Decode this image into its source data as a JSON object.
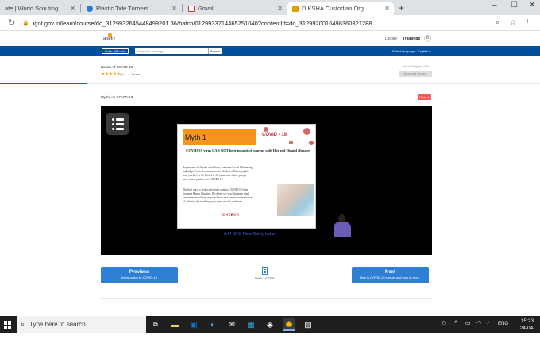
{
  "browser": {
    "tabs": [
      {
        "title": "ate | World Scouting",
        "active": false
      },
      {
        "title": "Plastic Tide Turners",
        "active": false
      },
      {
        "title": "Gmail",
        "active": false
      },
      {
        "title": "DIKSHA Custodian Org",
        "active": true
      }
    ],
    "new_tab": "+",
    "url": "igot.gov.in/learn/course/do_3129932645448499201 36/batch/0129933714465751040?contentId=do_3129920016498360321288",
    "window_controls": {
      "minimize": "–",
      "maximize": "☐",
      "close": "✕"
    }
  },
  "header": {
    "logo_text": "iGOT",
    "links": {
      "library": "Library",
      "trainings": "Trainings"
    },
    "avatar_initial": "D"
  },
  "nav": {
    "qr_label": "Enter QR code",
    "search_placeholder": "Search in trainings",
    "search_button": "Search",
    "language_label": "Select language :",
    "language_value": "English ▾"
  },
  "course": {
    "title": "Basics of COVID-19",
    "stars": "★★★★★",
    "rating_count": "(4)",
    "share_label": "< Share",
    "progress_label": "Your Progress 0%",
    "progress_button": "Download Content",
    "progress_fraction": 0.16
  },
  "content": {
    "title": "Myths on COVID-19",
    "close_label": "Close ✕"
  },
  "slide": {
    "heading": "Myth 1",
    "covid_label": "COVID - 19",
    "lead": "COVID-19 virus CAN NOT be transmitted in areas with Hot and Humid climates",
    "bullets": [
      "Regardless of climate conditions, maintain Social Distancing and adopt Protective measures in whichever Demographic area you live in Or Travel to Or in an area where people have tested positive for COVID-19",
      "The best way to protect yourself against COVID-19 is by frequent Hands Washing. By doing so, you eliminate viral contamination if any on your hands and prevent transmission of infection by touching your eyes, mouth, and nose"
    ],
    "verdict": "UNTRUE"
  },
  "video": {
    "caption": "A I I M S, New Delhi, India"
  },
  "navigation": {
    "previous": {
      "label": "Previous",
      "sub": "Introduction to COVID-19"
    },
    "take_notes": "TAKE NOTES",
    "next": {
      "label": "Next",
      "sub": "How is COVID-19 spread and how to prot..."
    }
  },
  "taskbar": {
    "search_placeholder": "Type here to search",
    "tray": {
      "language": "ENG"
    },
    "time": "15:23",
    "date": "24-04-2020"
  }
}
